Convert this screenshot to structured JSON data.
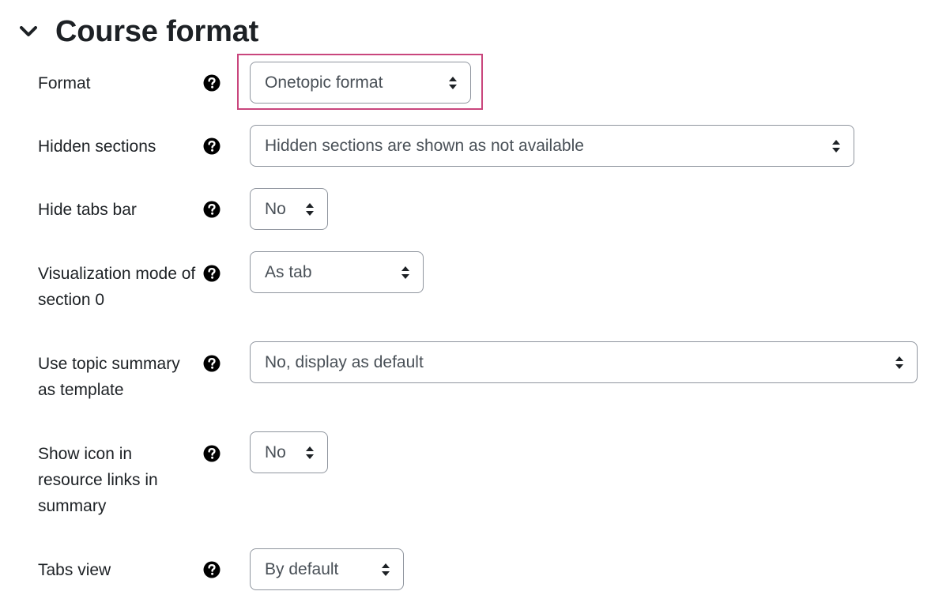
{
  "section": {
    "title": "Course format",
    "collapse_icon": "chevron-down-icon"
  },
  "fields": [
    {
      "label": "Format",
      "value": "Onetopic format",
      "help_icon": "question-circle-icon"
    },
    {
      "label": "Hidden sections",
      "value": "Hidden sections are shown as not available",
      "help_icon": "question-circle-icon"
    },
    {
      "label": "Hide tabs bar",
      "value": "No",
      "help_icon": "question-circle-icon"
    },
    {
      "label": "Visualization mode of section 0",
      "value": "As tab",
      "help_icon": "question-circle-icon"
    },
    {
      "label": "Use topic summary as template",
      "value": "No, display as default",
      "help_icon": "question-circle-icon"
    },
    {
      "label": "Show icon in resource links in summary",
      "value": "No",
      "help_icon": "question-circle-icon"
    },
    {
      "label": "Tabs view",
      "value": "By default",
      "help_icon": "question-circle-icon"
    }
  ],
  "colors": {
    "text": "#1d2125",
    "select_text": "#495057",
    "select_border": "#8f959e",
    "highlight_border": "#c9467d"
  }
}
